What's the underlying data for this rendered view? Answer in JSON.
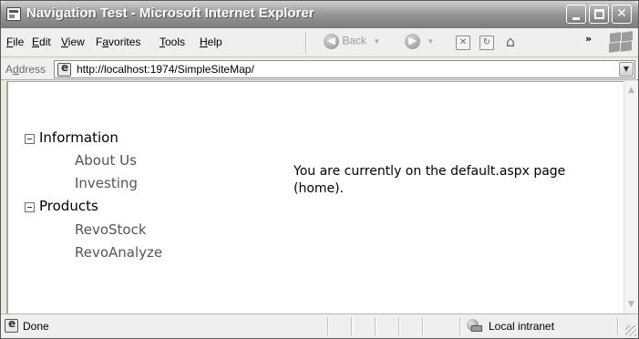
{
  "window": {
    "title": "Navigation Test - Microsoft Internet Explorer",
    "min_label": "_",
    "close_label": "✕"
  },
  "menu": {
    "file_u": "F",
    "file_rest": "ile",
    "edit_u": "E",
    "edit_rest": "dit",
    "view_u": "V",
    "view_rest": "iew",
    "favorites_pre": "F",
    "favorites_u": "a",
    "favorites_rest": "vorites",
    "tools_u": "T",
    "tools_rest": "ools",
    "help_u": "H",
    "help_rest": "elp"
  },
  "toolbar": {
    "back_label": "Back",
    "back_glyph": "◀",
    "forward_glyph": "▶",
    "caret": "▼",
    "stop_glyph": "✕",
    "refresh_glyph": "↻",
    "home_glyph": "⌂",
    "more_glyph": "»"
  },
  "address": {
    "label_pre": "A",
    "label_u": "d",
    "label_rest": "dress",
    "url": "http://localhost:1974/SimpleSiteMap/",
    "drop_glyph": "▼"
  },
  "tree": {
    "nodes": [
      {
        "label": "Information",
        "children": [
          "About Us",
          "Investing"
        ]
      },
      {
        "label": "Products",
        "children": [
          "RevoStock",
          "RevoAnalyze"
        ]
      }
    ]
  },
  "main": {
    "message": "You are currently on the default.aspx page (home)."
  },
  "scroll": {
    "up_glyph": "▲",
    "down_glyph": "▼"
  },
  "status": {
    "text": "Done",
    "zone": "Local intranet"
  },
  "colors": {
    "title_bar": "#9a9a9a",
    "chrome": "#efefef",
    "content_bg": "#ffffff"
  }
}
